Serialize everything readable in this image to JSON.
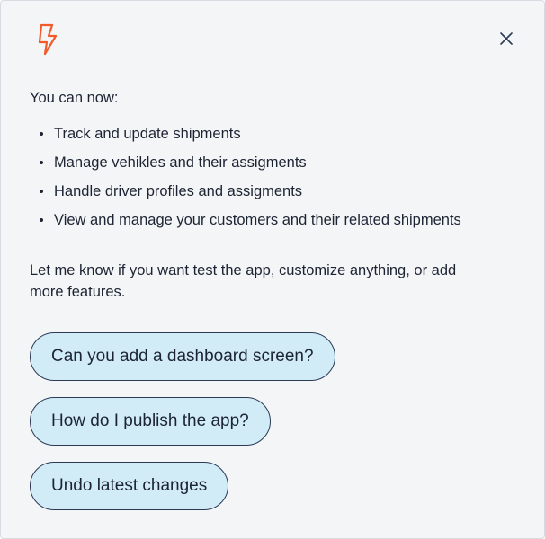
{
  "header": {
    "logo_icon": "lightning-bolt-icon",
    "logo_color": "#f25a2a",
    "close_icon": "close-icon"
  },
  "message": {
    "intro": "You can now:",
    "features": [
      "Track and update shipments",
      "Manage vehikles and their assigments",
      "Handle driver profiles and assigments",
      "View and manage your customers and their related shipments"
    ],
    "outro": "Let me know if you want test the app, customize anything, or add more features."
  },
  "suggestions": [
    "Can you add a dashboard screen?",
    "How do I publish the app?",
    "Undo latest changes"
  ],
  "colors": {
    "panel_bg": "#f4f5f7",
    "chip_bg": "#d2ecf7",
    "chip_border": "#2b3a55",
    "text": "#1c2433"
  }
}
